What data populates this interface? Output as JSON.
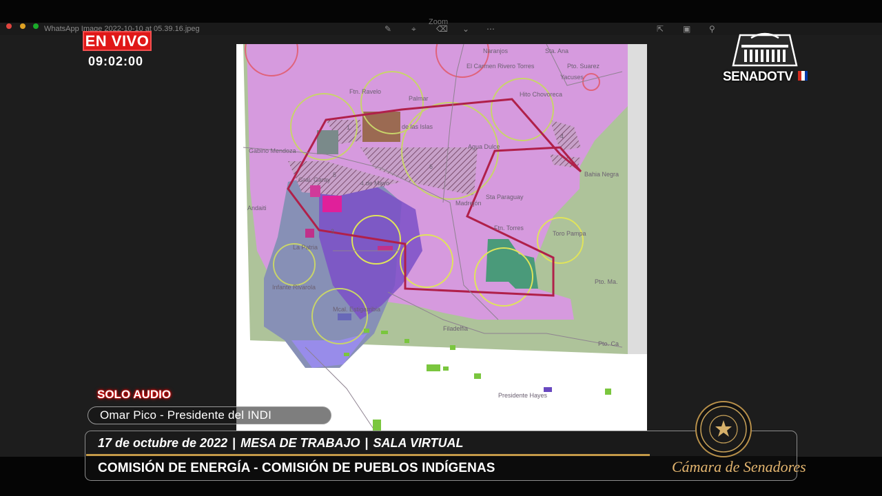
{
  "viewer": {
    "filename": "WhatsApp Image 2022-10-10 at 05.39.16.jpeg",
    "zoom_label": "Zoom"
  },
  "map": {
    "labels": {
      "naranjos": "Naranjos",
      "sta_ana": "Sta. Ana",
      "el_carmen": "El Carmen Rivero Torres",
      "pto_suarez": "Pto. Suarez",
      "yacuses": "Yacuses",
      "ftn_ravelo": "Ftn. Ravelo",
      "palmar": "Palmar",
      "de_las_islas": "de las Islas",
      "hito_chovoreca": "Hito Chovoreca",
      "gabino_mendoza": "Gabino Mendoza",
      "agua_dulce": "Agua Dulce",
      "bahia_negra": "Bahia Negra",
      "gral_garay": "Gral. Garay",
      "cuatro_de_mayo": "4 de Mayo",
      "madrejon": "Madrejón",
      "sta_paraguay": "Sta Paraguay",
      "andaiti": "Andaiti",
      "ftn_torres": "Ftn. Torres",
      "toro_pampa": "Toro Pampa",
      "la_patria": "La Patria",
      "infante_rivarola": "Infante Rivarola",
      "pto_ma": "Pto. Ma.",
      "mcal_estigarribia": "Mcal. Estigarribia",
      "filadelfia": "Filadelfia",
      "pto_ca": "Pto. Ca",
      "presidente_hayes": "Presidente Hayes",
      "n1": "1",
      "n3": "3",
      "n4": "4",
      "n5": "5",
      "n6": "6"
    }
  },
  "broadcast": {
    "live_label": "EN VIVO",
    "time": "09:02:00",
    "channel_name": "SENADOTV",
    "audio_label": "SOLO AUDIO",
    "speaker": "Omar Pico - Presidente del INDI",
    "date": "17 de octubre de 2022",
    "session_type": "MESA DE TRABAJO",
    "room": "SALA VIRTUAL",
    "separator": "|",
    "commission": "COMISIÓN DE ENERGÍA - COMISIÓN DE PUEBLOS INDÍGENAS",
    "chamber": "Cámara de Senadores"
  },
  "colors": {
    "live_red": "#e01818",
    "gold": "#c49a48",
    "map_pink": "#d69ade",
    "map_green": "#aec39a",
    "map_purple": "#7b50c8",
    "boundary_red": "#b0204a"
  }
}
